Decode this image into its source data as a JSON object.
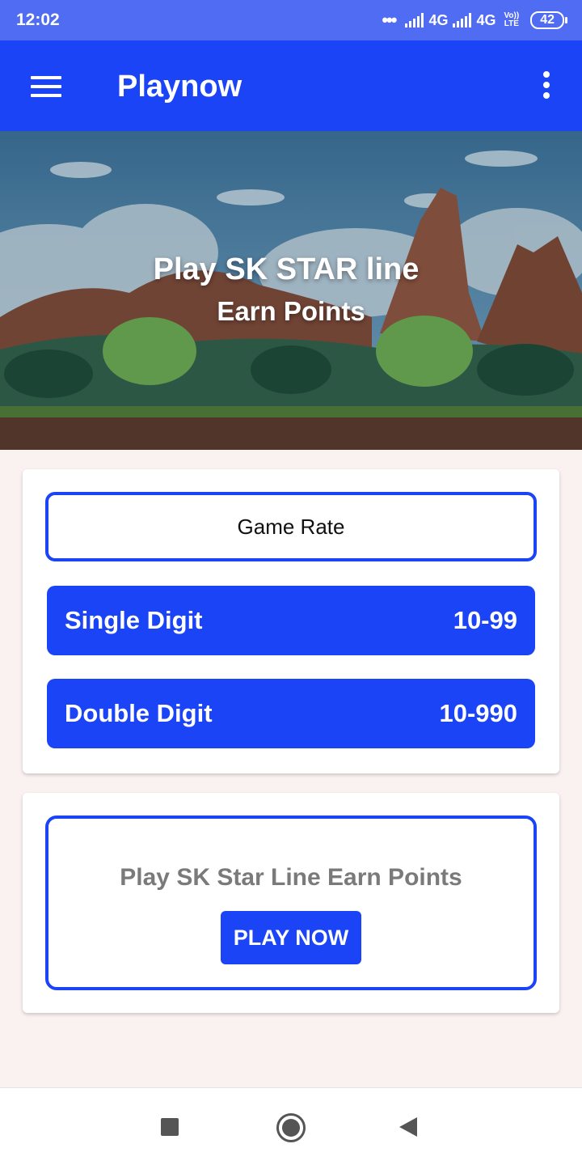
{
  "status_bar": {
    "time": "12:02",
    "network1": "4G",
    "network2": "4G",
    "volte_top": "Vo))",
    "volte_bottom": "LTE",
    "battery": "42"
  },
  "app_bar": {
    "title": "Playnow",
    "menu_icon": "hamburger-menu-icon",
    "overflow_icon": "more-vertical-icon",
    "color": "#1a44f5"
  },
  "banner": {
    "line1": "Play SK STAR line",
    "line2": "Earn Points"
  },
  "game_rates": {
    "header": "Game Rate",
    "rows": [
      {
        "label": "Single Digit",
        "value": "10-99"
      },
      {
        "label": "Double Digit",
        "value": "10-990"
      }
    ]
  },
  "play_card": {
    "heading": "Play SK Star Line Earn Points",
    "button": "PLAY NOW"
  },
  "nav_bar": {
    "recents_icon": "square-icon",
    "home_icon": "circle-home-icon",
    "back_icon": "triangle-back-icon"
  }
}
